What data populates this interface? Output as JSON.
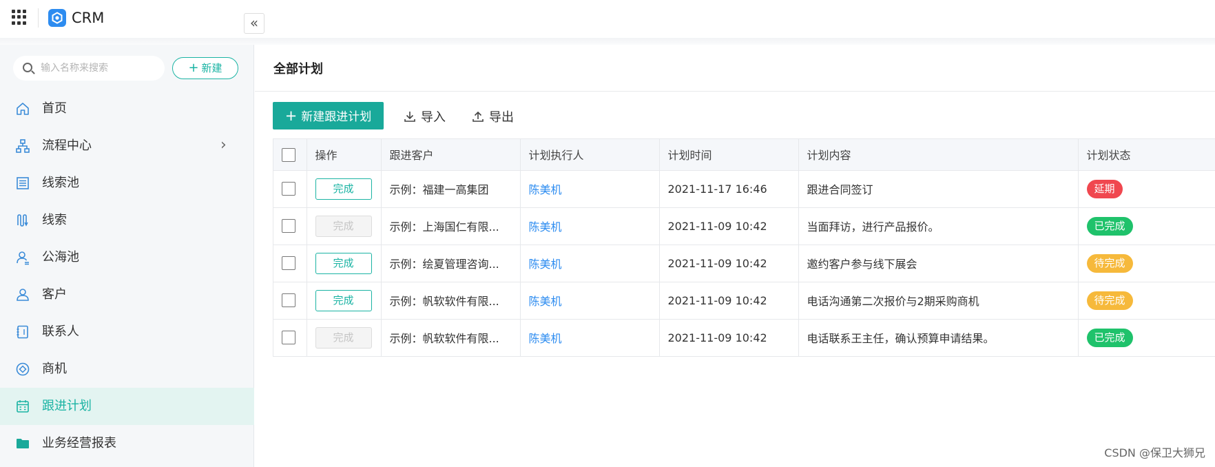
{
  "app": {
    "title": "CRM"
  },
  "sidebar": {
    "search_placeholder": "输入名称来搜索",
    "new_button": "新建",
    "collapse_icon": "«",
    "items": [
      {
        "label": "首页",
        "icon": "home-icon"
      },
      {
        "label": "流程中心",
        "icon": "flow-icon",
        "has_submenu": true
      },
      {
        "label": "线索池",
        "icon": "lead-pool-icon"
      },
      {
        "label": "线索",
        "icon": "lead-icon"
      },
      {
        "label": "公海池",
        "icon": "public-pool-icon"
      },
      {
        "label": "客户",
        "icon": "customer-icon"
      },
      {
        "label": "联系人",
        "icon": "contact-icon"
      },
      {
        "label": "商机",
        "icon": "opportunity-icon"
      },
      {
        "label": "跟进计划",
        "icon": "calendar-icon",
        "active": true
      },
      {
        "label": "业务经营报表",
        "icon": "folder-icon"
      }
    ]
  },
  "main": {
    "title": "全部计划",
    "toolbar": {
      "new_plan": "新建跟进计划",
      "import": "导入",
      "export": "导出"
    },
    "table": {
      "columns": [
        "操作",
        "跟进客户",
        "计划执行人",
        "计划时间",
        "计划内容",
        "计划状态"
      ],
      "rows": [
        {
          "action": "完成",
          "action_enabled": true,
          "customer": "示例：福建一高集团",
          "executor": "陈美机",
          "time": "2021-11-17 16:46",
          "content": "跟进合同签订",
          "status": "延期"
        },
        {
          "action": "完成",
          "action_enabled": false,
          "customer": "示例：上海国仁有限...",
          "executor": "陈美机",
          "time": "2021-11-09 10:42",
          "content": "当面拜访，进行产品报价。",
          "status": "已完成"
        },
        {
          "action": "完成",
          "action_enabled": true,
          "customer": "示例：绘夏管理咨询...",
          "executor": "陈美机",
          "time": "2021-11-09 10:42",
          "content": "邀约客户参与线下展会",
          "status": "待完成"
        },
        {
          "action": "完成",
          "action_enabled": true,
          "customer": "示例：帆软软件有限...",
          "executor": "陈美机",
          "time": "2021-11-09 10:42",
          "content": "电话沟通第二次报价与2期采购商机",
          "status": "待完成"
        },
        {
          "action": "完成",
          "action_enabled": false,
          "customer": "示例：帆软软件有限...",
          "executor": "陈美机",
          "time": "2021-11-09 10:42",
          "content": "电话联系王主任，确认预算申请结果。",
          "status": "已完成"
        }
      ]
    }
  },
  "status_colors": {
    "延期": "#f0474f",
    "已完成": "#1fc26b",
    "待完成": "#f6b93b"
  },
  "accent_color": "#19a99a",
  "watermark": "CSDN @保卫大狮兄"
}
